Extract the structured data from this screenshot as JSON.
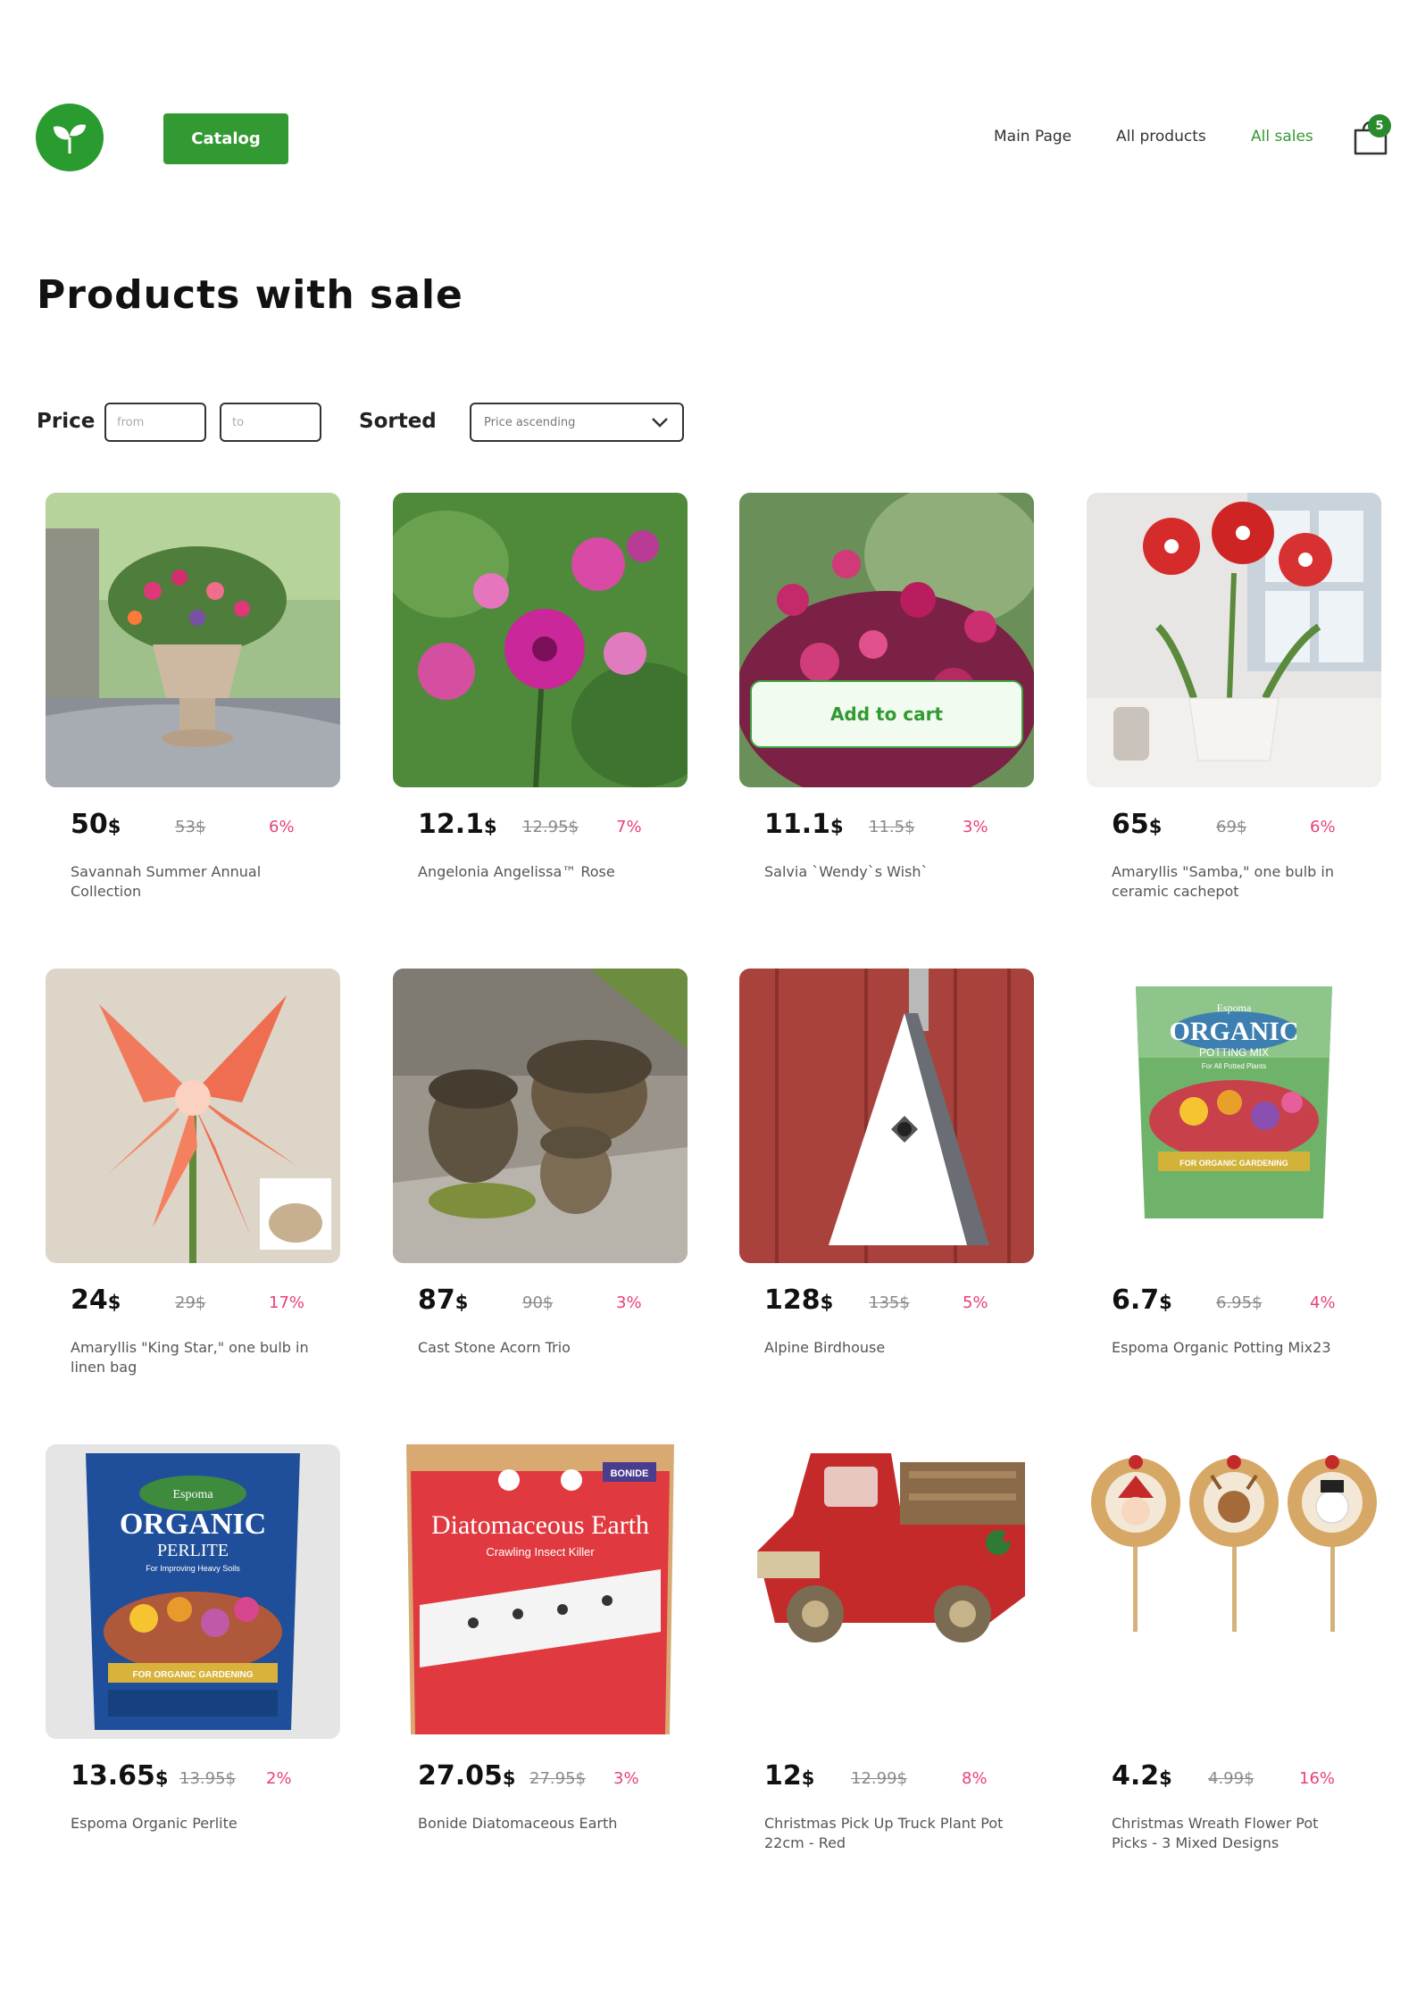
{
  "header": {
    "catalog_label": "Catalog",
    "nav": [
      "Main Page",
      "All products",
      "All sales"
    ],
    "cart_count": "5"
  },
  "page_title": "Products with sale",
  "filters": {
    "price_label": "Price",
    "from_placeholder": "from",
    "to_placeholder": "to",
    "sorted_label": "Sorted",
    "sort_value": "Price ascending"
  },
  "add_to_cart_label": "Add to cart",
  "currency": "$",
  "products": [
    {
      "price": "50",
      "old": "53$",
      "pct": "6%",
      "name": "Savannah Summer Annual Collection"
    },
    {
      "price": "12.1",
      "old": "12.95$",
      "pct": "7%",
      "name": "Angelonia Angelissa™ Rose"
    },
    {
      "price": "11.1",
      "old": "11.5$",
      "pct": "3%",
      "name": "Salvia `Wendy`s Wish`"
    },
    {
      "price": "65",
      "old": "69$",
      "pct": "6%",
      "name": "Amaryllis \"Samba,\" one bulb in ceramic cachepot"
    },
    {
      "price": "24",
      "old": "29$",
      "pct": "17%",
      "name": "Amaryllis \"King Star,\" one bulb in linen bag"
    },
    {
      "price": "87",
      "old": "90$",
      "pct": "3%",
      "name": "Cast Stone Acorn Trio"
    },
    {
      "price": "128",
      "old": "135$",
      "pct": "5%",
      "name": "Alpine Birdhouse"
    },
    {
      "price": "6.7",
      "old": "6.95$",
      "pct": "4%",
      "name": "Espoma Organic Potting Mix23"
    },
    {
      "price": "13.65",
      "old": "13.95$",
      "pct": "2%",
      "name": "Espoma Organic Perlite"
    },
    {
      "price": "27.05",
      "old": "27.95$",
      "pct": "3%",
      "name": "Bonide Diatomaceous Earth"
    },
    {
      "price": "12",
      "old": "12.99$",
      "pct": "8%",
      "name": "Christmas Pick Up Truck Plant Pot 22cm - Red"
    },
    {
      "price": "4.2",
      "old": "4.99$",
      "pct": "16%",
      "name": "Christmas Wreath Flower Pot Picks - 3 Mixed Designs"
    }
  ],
  "image_text": {
    "potting_mix": [
      "Espoma",
      "ORGANIC",
      "POTTING MIX",
      "For All Potted Plants",
      "FOR ORGANIC GARDENING"
    ],
    "perlite": [
      "Espoma",
      "ORGANIC",
      "PERLITE",
      "For Improving Heavy Soils",
      "FOR ORGANIC GARDENING"
    ],
    "diatomaceous": [
      "Diatomaceous Earth",
      "Crawling Insect Killer",
      "BONIDE"
    ]
  },
  "colors": {
    "brand_green": "#339933",
    "sale_pink": "#e8407a"
  },
  "icons": [
    "sprout-logo-icon",
    "shopping-bag-icon",
    "chevron-down-icon"
  ]
}
